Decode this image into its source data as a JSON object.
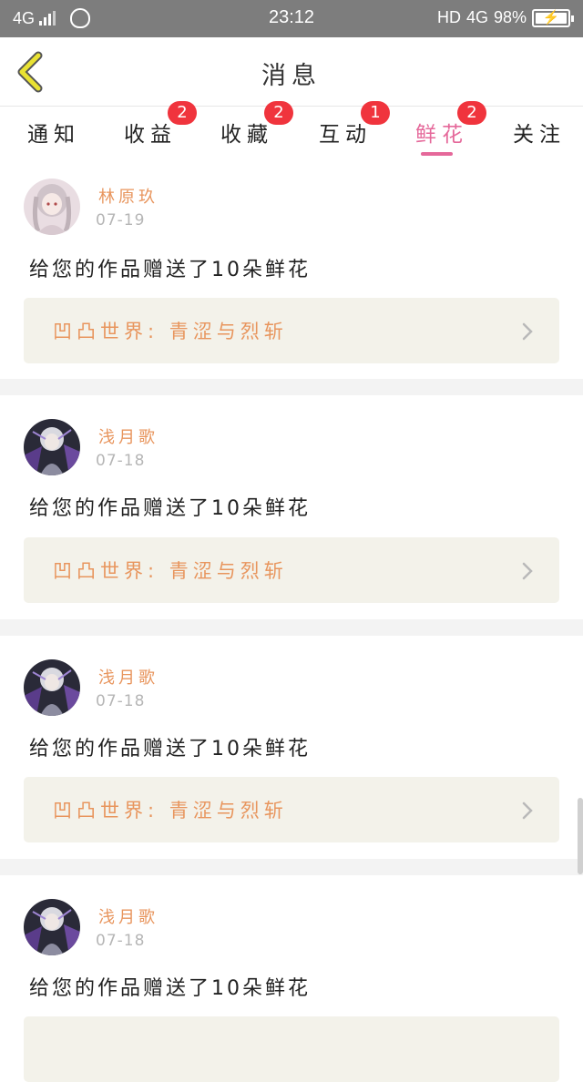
{
  "status_bar": {
    "network": "4G",
    "time": "23:12",
    "right_hd": "HD",
    "right_network": "4G",
    "battery": "98%"
  },
  "header": {
    "title": "消息",
    "back_icon": "chevron-left-icon"
  },
  "tabs": [
    {
      "label": "通知",
      "badge": ""
    },
    {
      "label": "收益",
      "badge": "2"
    },
    {
      "label": "收藏",
      "badge": "2"
    },
    {
      "label": "互动",
      "badge": "1"
    },
    {
      "label": "鲜花",
      "badge": "2"
    },
    {
      "label": "关注",
      "badge": ""
    }
  ],
  "active_tab": "鲜花",
  "messages": [
    {
      "user": "林原玖",
      "date": "07-19",
      "text": "给您的作品赠送了10朵鲜花",
      "work": "凹凸世界:  青涩与烈斩"
    },
    {
      "user": "浅月歌",
      "date": "07-18",
      "text": "给您的作品赠送了10朵鲜花",
      "work": "凹凸世界:  青涩与烈斩"
    },
    {
      "user": "浅月歌",
      "date": "07-18",
      "text": "给您的作品赠送了10朵鲜花",
      "work": "凹凸世界:  青涩与烈斩"
    },
    {
      "user": "浅月歌",
      "date": "07-18",
      "text": "给您的作品赠送了10朵鲜花",
      "work": ""
    }
  ],
  "colors": {
    "accent": "#e5689a",
    "badge": "#f0343d",
    "username": "#e8955d",
    "back_arrow": "#e9e233"
  }
}
